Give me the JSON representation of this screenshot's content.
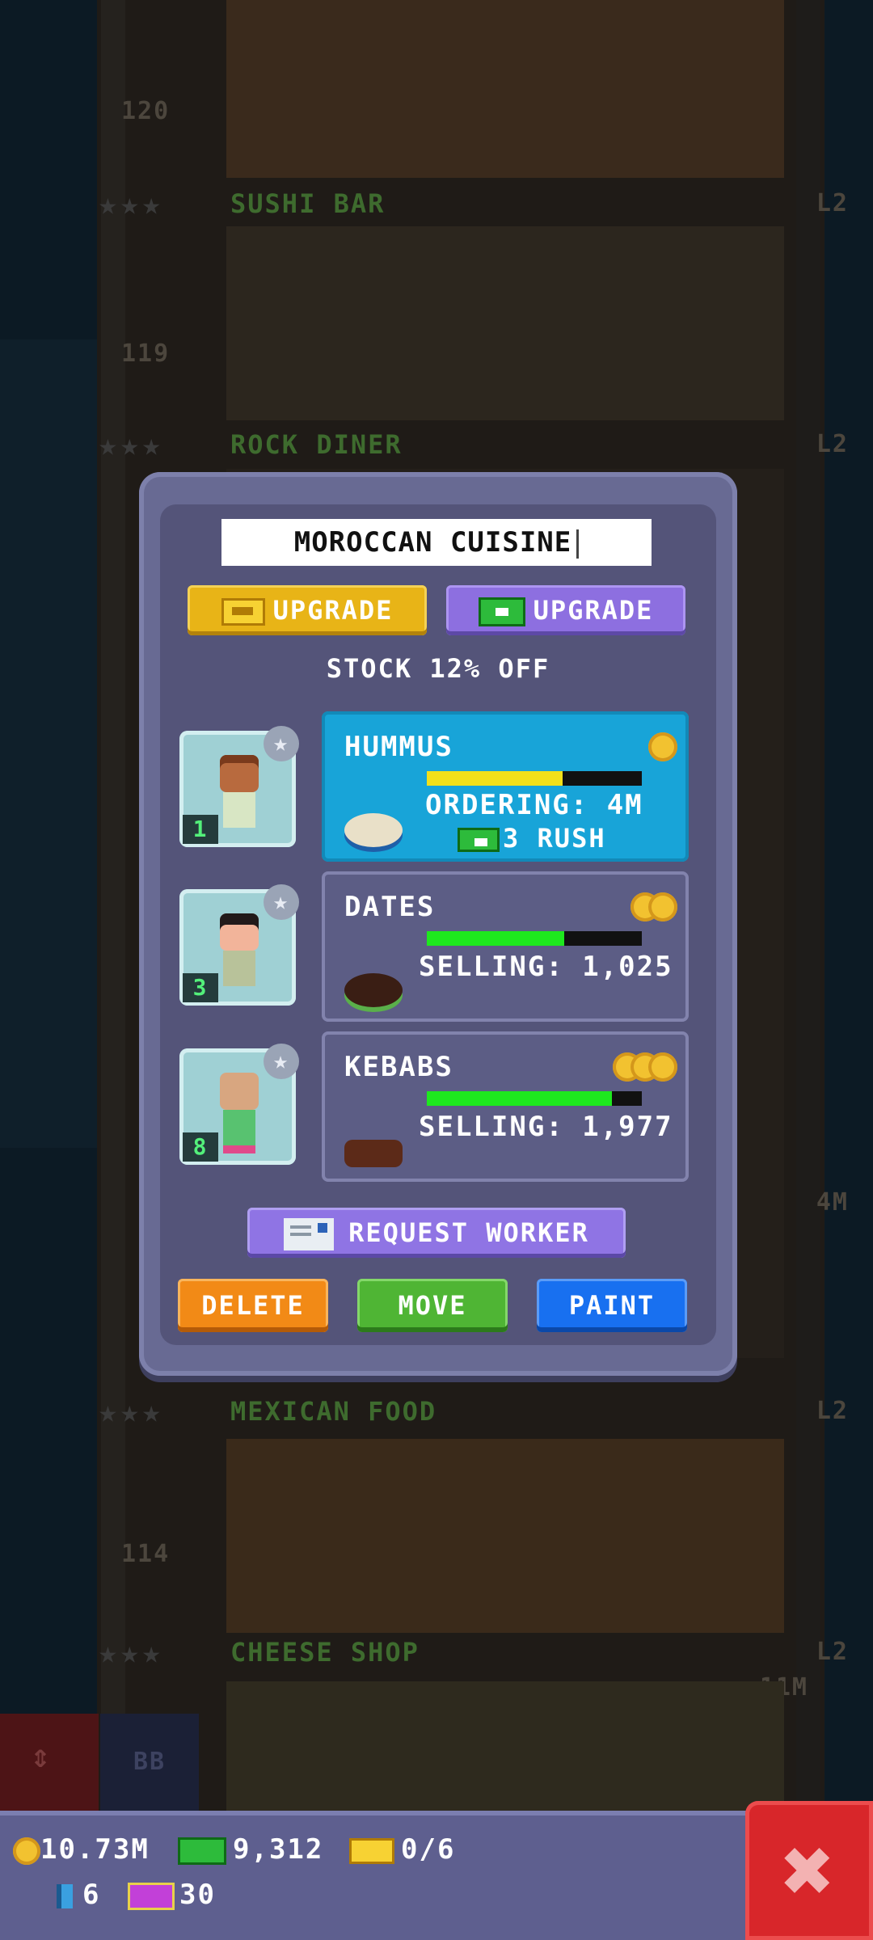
{
  "tower": {
    "floors": [
      {
        "label": "SUSHI BAR",
        "number": "120",
        "level": "L2"
      },
      {
        "label": "ROCK DINER",
        "number": "119",
        "level": "L2"
      },
      {
        "label": "MEXICAN FOOD",
        "number": "",
        "level": "L2"
      },
      {
        "label": "CHEESE SHOP",
        "number": "114",
        "level": "L2"
      }
    ],
    "side_labels": {
      "bb": "BB",
      "price_11m": "11M",
      "price_4m": "4M"
    }
  },
  "dialog": {
    "name_field": "MOROCCAN CUISINE",
    "upgrade_coins_label": "UPGRADE",
    "upgrade_bux_label": "UPGRADE",
    "stock_text": "STOCK 12% OFF",
    "workers": [
      {
        "level": "1",
        "icon": "star-icon"
      },
      {
        "level": "3",
        "icon": "star-icon"
      },
      {
        "level": "8",
        "icon": "star-icon"
      }
    ],
    "products": [
      {
        "name": "HUMMUS",
        "status": "ORDERING: 4M",
        "rush": "3 RUSH",
        "progress": 0.63,
        "bar_color": "#f2e01a",
        "state": "ordering"
      },
      {
        "name": "DATES",
        "status": "SELLING: 1,025",
        "progress": 0.64,
        "bar_color": "#1ee81e",
        "state": "selling"
      },
      {
        "name": "KEBABS",
        "status": "SELLING: 1,977",
        "progress": 0.86,
        "bar_color": "#1ee81e",
        "state": "selling"
      }
    ],
    "request_worker_label": "REQUEST WORKER",
    "delete_label": "DELETE",
    "move_label": "MOVE",
    "paint_label": "PAINT"
  },
  "bottom_bar": {
    "coins": "10.73M",
    "bux": "9,312",
    "tickets": "0/6",
    "bitizens": "6",
    "vip": "30"
  },
  "colors": {
    "dialog_bg": "#545479",
    "active_card": "#18a4d8",
    "delete": "#f28a16",
    "move": "#4fb534",
    "paint": "#1870f0",
    "close": "#d8262a"
  }
}
